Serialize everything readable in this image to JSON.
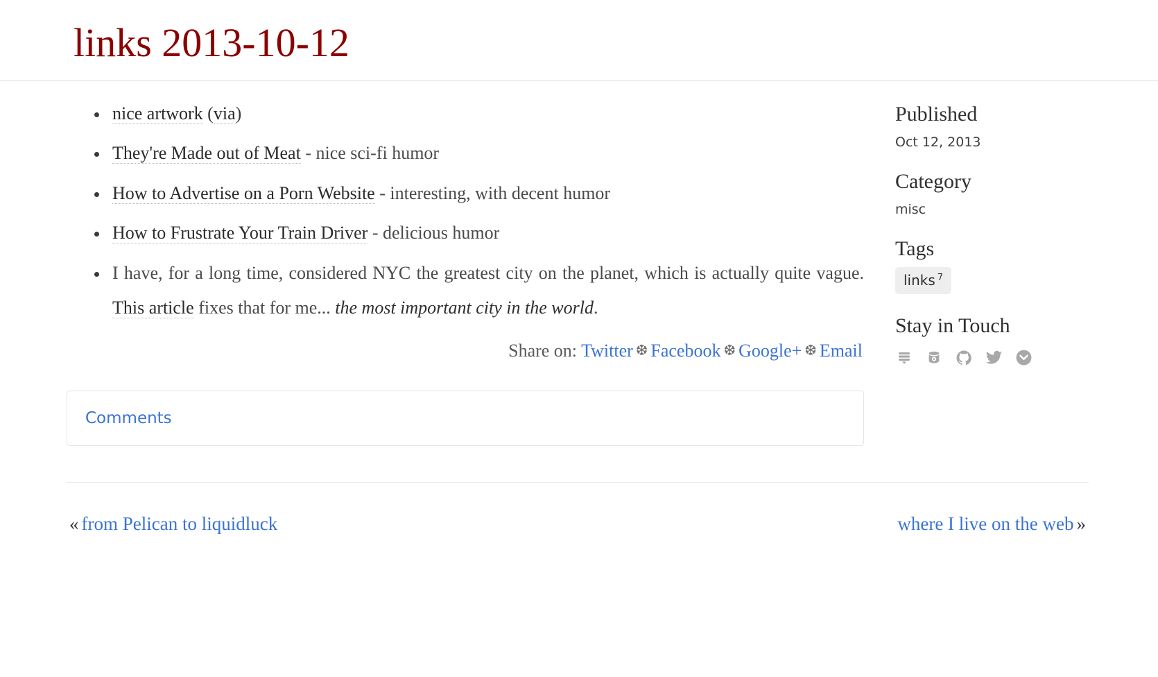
{
  "post": {
    "title": "links 2013-10-12",
    "items": [
      {
        "link_text": "nice artwork",
        "suffix_pre": " (",
        "second_link_text": "via",
        "suffix_post": ")",
        "note": ""
      },
      {
        "link_text": "They're Made out of Meat",
        "note": " - nice sci-fi humor"
      },
      {
        "link_text": "How to Advertise on a Porn Website",
        "note": " - interesting, with decent humor"
      },
      {
        "link_text": "How to Frustrate Your Train Driver",
        "note": " - delicious humor"
      }
    ],
    "paragraph_item": {
      "text_before": "I have, for a long time, considered NYC the greatest city on the planet, which is actually quite vague. ",
      "link_text": "This article",
      "text_after": " fixes that for me... ",
      "italic_text": "the most important city in the world",
      "text_end": "."
    }
  },
  "share": {
    "label": "Share on:",
    "separator": "❆",
    "links": [
      {
        "label": "Twitter",
        "name": "share-twitter-link"
      },
      {
        "label": "Facebook",
        "name": "share-facebook-link"
      },
      {
        "label": "Google+",
        "name": "share-googleplus-link"
      },
      {
        "label": "Email",
        "name": "share-email-link"
      }
    ]
  },
  "comments": {
    "label": "Comments"
  },
  "sidebar": {
    "published_heading": "Published",
    "published_value": "Oct 12, 2013",
    "category_heading": "Category",
    "category_value": "misc",
    "tags_heading": "Tags",
    "tags": [
      {
        "label": "links",
        "count": "7"
      }
    ],
    "social_heading": "Stay in Touch",
    "social_icons": [
      "feed-stack-icon",
      "instagram-icon",
      "github-icon",
      "twitter-icon",
      "pocket-icon"
    ]
  },
  "footer_nav": {
    "prev_marker": "«",
    "prev_label": "from Pelican to liquidluck",
    "next_label": "where I live on the web",
    "next_marker": "»"
  },
  "colors": {
    "title": "#8b0000",
    "link_blue": "#3b73d3",
    "tag_bg": "#eeeeee",
    "icon_gray": "#a8a8a8"
  }
}
